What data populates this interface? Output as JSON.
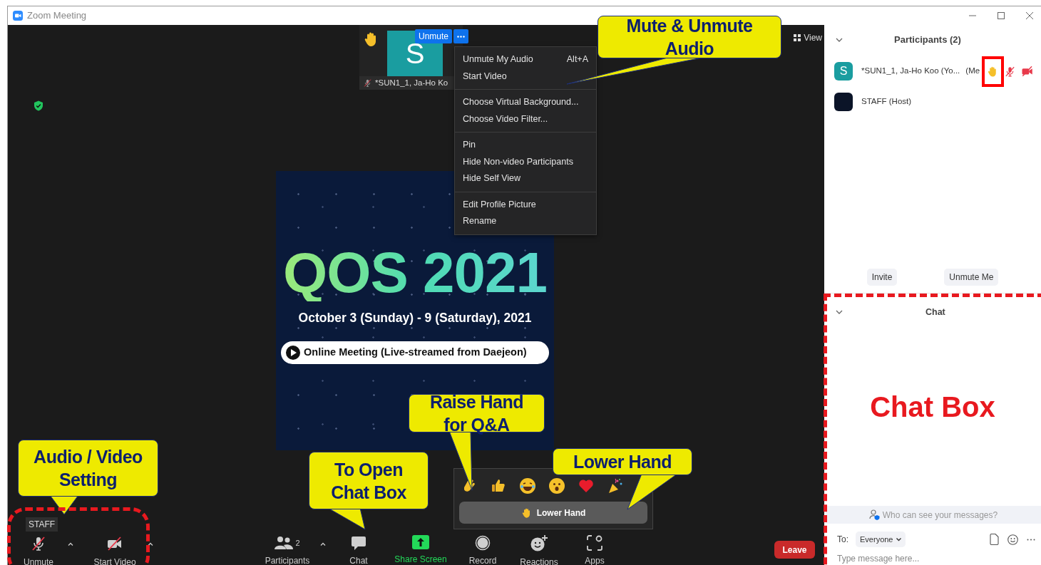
{
  "window": {
    "title": "Zoom Meeting"
  },
  "self_view": {
    "initial": "S",
    "name": "*SUN1_1, Ja-Ho Ko",
    "hand_raised": true,
    "muted": true,
    "unmute_button": "Unmute"
  },
  "view_button": "View",
  "context_menu": [
    [
      {
        "label": "Unmute My Audio",
        "shortcut": "Alt+A"
      },
      {
        "label": "Start Video"
      }
    ],
    [
      {
        "label": "Choose Virtual Background..."
      },
      {
        "label": "Choose Video Filter..."
      }
    ],
    [
      {
        "label": "Pin"
      },
      {
        "label": "Hide Non-video Participants"
      },
      {
        "label": "Hide Self View"
      }
    ],
    [
      {
        "label": "Edit Profile Picture"
      },
      {
        "label": "Rename"
      }
    ]
  ],
  "shared_slide": {
    "title": "QOS 2021",
    "dates": "October 3 (Sunday) - 9 (Saturday), 2021",
    "link": "Online Meeting (Live-streamed from Daejeon)"
  },
  "reactions_popup": {
    "lower_hand_button": "Lower Hand"
  },
  "name_tag": "STAFF",
  "toolbar": [
    {
      "kind": "audio",
      "label": "Unmute",
      "muted": true,
      "caret": true
    },
    {
      "kind": "video",
      "label": "Start Video",
      "video_off": true,
      "caret": true
    },
    {
      "kind": "participants",
      "label": "Participants",
      "count": "2",
      "caret": true
    },
    {
      "kind": "chat",
      "label": "Chat"
    },
    {
      "kind": "share",
      "label": "Share Screen"
    },
    {
      "kind": "record",
      "label": "Record"
    },
    {
      "kind": "reactions",
      "label": "Reactions"
    },
    {
      "kind": "apps",
      "label": "Apps"
    }
  ],
  "leave_button": "Leave",
  "participants_panel": {
    "title": "Participants (2)",
    "participants": [
      {
        "kind": "initial",
        "initial": "S",
        "name": "*SUN1_1, Ja-Ho Koo (Yo...",
        "tag": "(Me",
        "hand_raised": true,
        "muted": true,
        "video_off": true
      },
      {
        "kind": "logo",
        "name": "STAFF (Host)"
      }
    ],
    "buttons": [
      "Invite",
      "Unmute Me"
    ]
  },
  "chat_panel": {
    "title": "Chat",
    "notice": "Who can see your messages?",
    "to_label": "To:",
    "recipient": "Everyone",
    "placeholder": "Type message here..."
  },
  "annotations": [
    {
      "kind": "callout",
      "text": "Mute & Unmute Audio"
    },
    {
      "kind": "callout",
      "text": "Raise Hand for Q&A"
    },
    {
      "kind": "callout",
      "text": "Audio / Video Setting"
    },
    {
      "kind": "callout",
      "text": "To Open Chat Box"
    },
    {
      "kind": "callout",
      "text": "Lower Hand"
    }
  ],
  "chat_box_label": "Chat Box"
}
